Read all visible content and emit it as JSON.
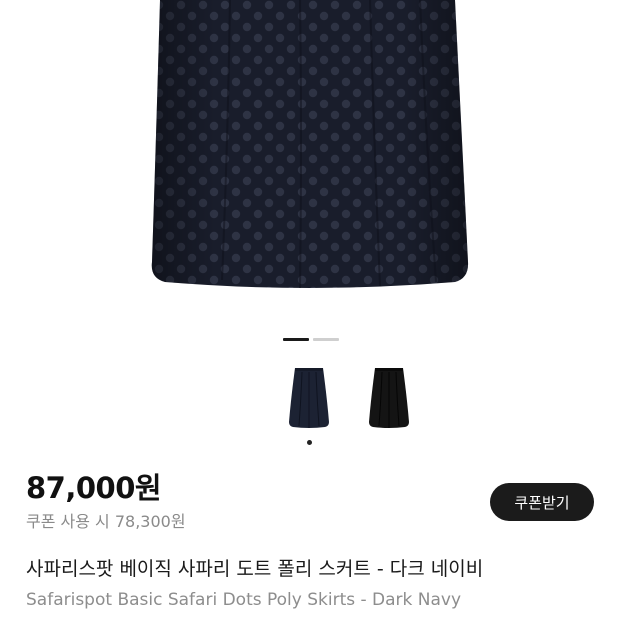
{
  "product": {
    "price": "87,000원",
    "coupon_price": "쿠폰 사용 시 78,300원",
    "coupon_button_label": "쿠폰받기",
    "title_korean": "사파리스팟 베이직 사파리 도트 폴리 스커트 - 다크 네이비",
    "title_english": "Safarispot Basic Safari Dots Poly Skirts - Dark Navy"
  },
  "gallery": {
    "image_count": 2,
    "active_index": 1,
    "thumbnails": [
      {
        "name": "skirt-navy-front"
      },
      {
        "name": "skirt-black-front"
      }
    ]
  },
  "colors": {
    "skirt": "#191d2b",
    "dots": "#2e3344",
    "button_bg": "#1b1b1b",
    "secondary_text": "#8a8a8a"
  }
}
